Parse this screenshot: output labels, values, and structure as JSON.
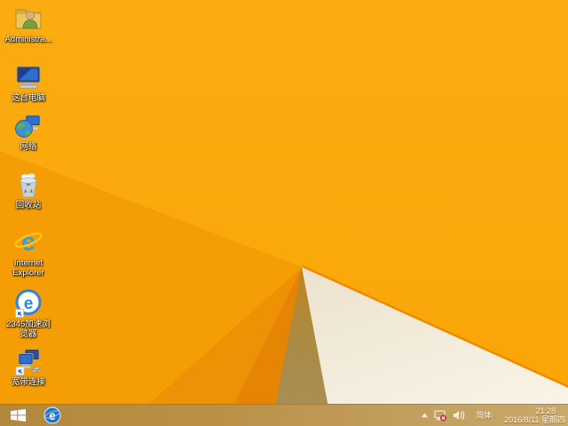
{
  "desktop": {
    "icons": [
      {
        "name": "administrator-folder",
        "lines": [
          "Administra..."
        ]
      },
      {
        "name": "this-pc",
        "lines": [
          "这台电脑"
        ]
      },
      {
        "name": "network",
        "lines": [
          "网络"
        ]
      },
      {
        "name": "recycle-bin",
        "lines": [
          "回收站"
        ]
      },
      {
        "name": "internet-explorer",
        "lines": [
          "Internet",
          "Explorer"
        ]
      },
      {
        "name": "2345-browser",
        "lines": [
          "2345加速浏",
          "览器"
        ]
      },
      {
        "name": "broadband-connection",
        "lines": [
          "宽带连接"
        ]
      }
    ]
  },
  "taskbar": {
    "tray": {
      "language_indicator": "简体",
      "time": "21:28",
      "date": "2016/8/11 星期四"
    }
  },
  "colors": {
    "wallpaper_amber": "#fba90c",
    "wallpaper_cream": "#f2ecdb",
    "wallpaper_olive": "#a68d55",
    "wallpaper_rim": "#ee8a00",
    "taskbar_tan": "#bb9148",
    "ie_blue": "#2e9fe8",
    "tray_alert_red": "#cc3333"
  }
}
